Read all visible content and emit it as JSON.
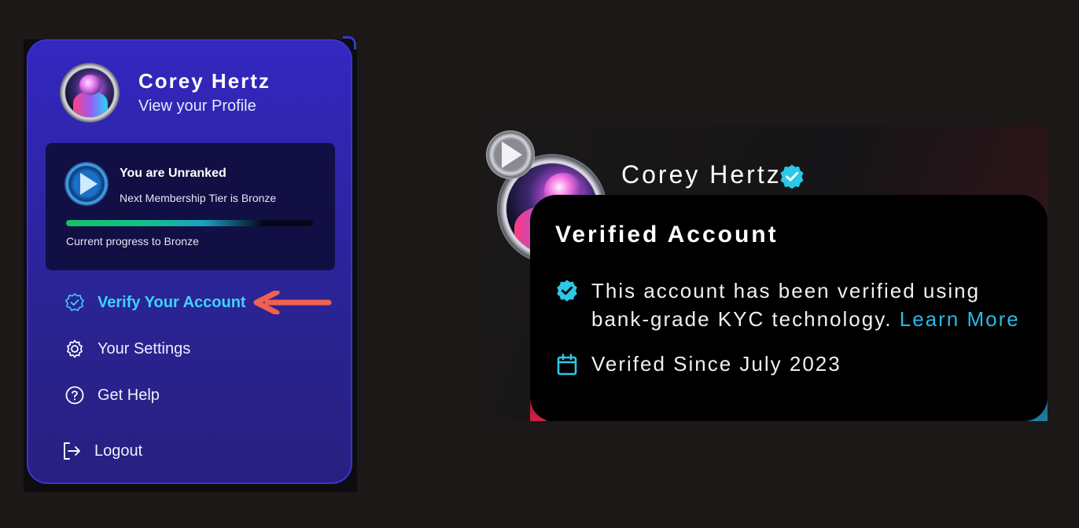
{
  "menu": {
    "user_name": "Corey Hertz",
    "view_profile": "View your Profile",
    "rank": {
      "title": "You are Unranked",
      "next_tier": "Next Membership Tier is Bronze",
      "progress_label": "Current progress to Bronze",
      "progress": 0.8
    },
    "items": [
      {
        "label": "Verify Your Account",
        "icon": "verify-badge-icon",
        "highlighted": true
      },
      {
        "label": "Your Settings",
        "icon": "gear-icon"
      },
      {
        "label": "Get Help",
        "icon": "help-circle-icon"
      },
      {
        "label": "Logout",
        "icon": "logout-icon"
      }
    ]
  },
  "profile_card": {
    "user_name": "Corey Hertz",
    "tooltip": {
      "title": "Verified Account",
      "description": "This account has been verified using bank-grade KYC technology.",
      "learn_more": "Learn More",
      "verified_since": "Verifed Since July 2023"
    }
  },
  "colors": {
    "accent_cyan": "#3fd2ff",
    "link": "#2ab8e8",
    "annotation_arrow": "#f0614f",
    "panel": "#2d25a6"
  }
}
